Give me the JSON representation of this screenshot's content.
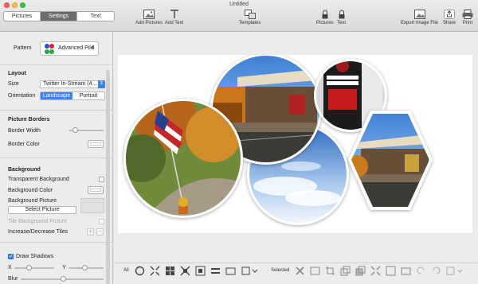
{
  "window": {
    "title": "Untitled"
  },
  "tabs": [
    {
      "label": "Pictures"
    },
    {
      "label": "Settings"
    },
    {
      "label": "Text"
    }
  ],
  "toolbar": {
    "add_pictures": "Add Pictures",
    "add_text": "Add Text",
    "templates": "Templates",
    "lock_pictures": "Pictures",
    "lock_text": "Text",
    "export": "Export Image File",
    "share": "Share",
    "print": "Print"
  },
  "sidebar": {
    "pattern_label": "Pattern",
    "pattern_value": "Advanced Pile",
    "layout_head": "Layout",
    "size_label": "Size",
    "size_value": "Twitter In-Stream (4...",
    "orientation_label": "Orientation",
    "orientation_options": [
      "Landscape",
      "Portrait"
    ],
    "orientation_selected": "Landscape",
    "borders_head": "Picture Borders",
    "border_width_label": "Border Width",
    "border_color_label": "Border Color",
    "background_head": "Background",
    "transparent_bg_label": "Transparent Background",
    "bg_color_label": "Background Color",
    "bg_picture_label": "Background Picture",
    "select_picture": "Select Picture",
    "tile_bg_label": "Tile Background Picture",
    "tiles_label": "Increase/Decrease Tiles",
    "draw_shadows_label": "Draw Shadows",
    "x_label": "X",
    "y_label": "Y",
    "blur_label": "Blur",
    "tiles_buttons": [
      "+",
      "−"
    ]
  },
  "bottom": {
    "all_label": "All",
    "selected_label": "Selected"
  },
  "colors": {
    "accent": "#3b82f0"
  },
  "icons": [
    "add-pictures-icon",
    "text-icon",
    "templates-icon",
    "lock-icon",
    "export-icon",
    "share-icon",
    "print-icon"
  ]
}
